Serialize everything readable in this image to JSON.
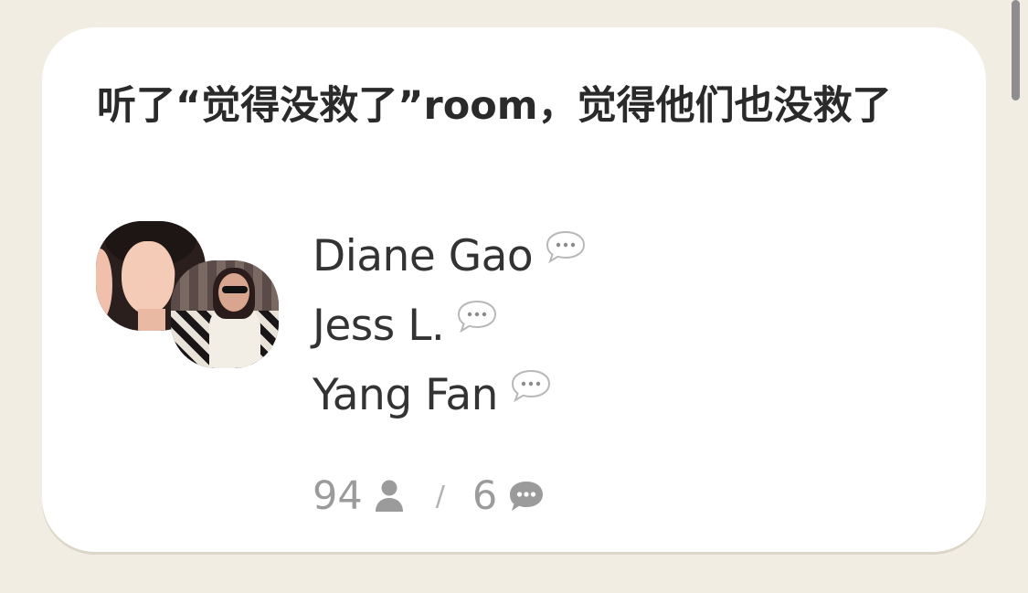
{
  "room": {
    "title": "听了“觉得没救了”room，觉得他们也没救了",
    "speakers": [
      {
        "name": "Diane Gao",
        "icon": "speech-bubble-icon"
      },
      {
        "name": "Jess L.",
        "icon": "speech-bubble-icon"
      },
      {
        "name": "Yang Fan",
        "icon": "speech-bubble-icon"
      }
    ],
    "stats": {
      "listeners": "94",
      "listeners_icon": "person-icon",
      "separator": "/",
      "speakers": "6",
      "speakers_icon": "chat-bubble-icon"
    }
  },
  "colors": {
    "background": "#f1ede3",
    "card": "#ffffff",
    "title_text": "#2a2a2a",
    "speaker_text": "#333333",
    "muted_text": "#9b9b9b"
  }
}
